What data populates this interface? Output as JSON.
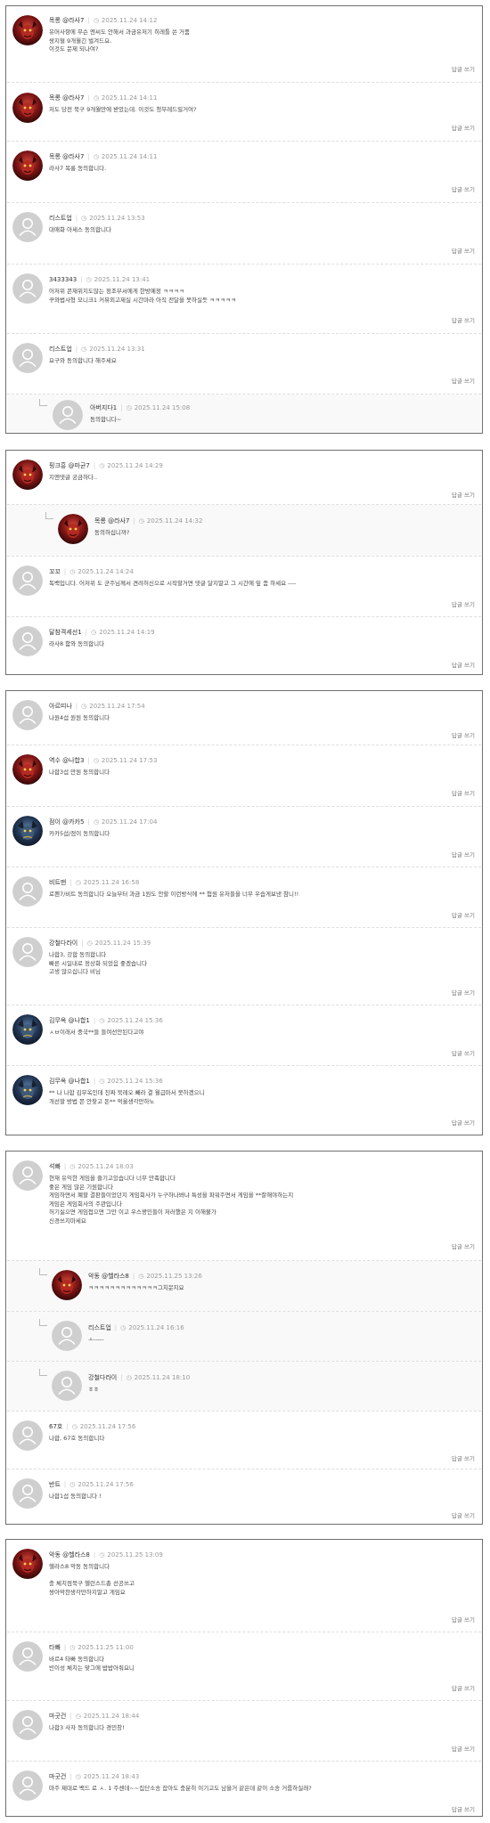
{
  "reply_label": "답글 쓰기",
  "threads": [
    {
      "comments": [
        {
          "author": "목롱 @라사7",
          "time": "2025.11.24 14:12",
          "avatar": "red",
          "text": "유머사항에 무슨 엔씨도 안해서 과금유저기 히레틀 쓴 거품\n쌍지혈 9개월긴 벌겨드요.\n이것도 문제 되나여?"
        },
        {
          "author": "목롱 @라사7",
          "time": "2025.11.24 14:11",
          "avatar": "red",
          "text": "저도 당전 북구 9개월만에 받았는데. 이것도 청무레드릴거여?"
        },
        {
          "author": "목롱 @라사7",
          "time": "2025.11.24 14:11",
          "avatar": "red",
          "text": "라사7 목롱 동의합니다."
        },
        {
          "author": "리스트업",
          "time": "2025.11.24 13:53",
          "avatar": "gray",
          "text": "대애화 아세스 동의합니다"
        },
        {
          "author": "3433343",
          "time": "2025.11.24 13:41",
          "avatar": "gray",
          "text": "어저위 콘재위지도많는 정조부서에게 한방예정 ㅋㅋㅋㅋ\n꾸와법사형 모니크1 커뮤외고제실 시간마라 아직 전달을 못하실듯 ㅋㅋㅋㅋㅋ"
        },
        {
          "author": "리스트업",
          "time": "2025.11.24 13:31",
          "avatar": "gray",
          "text": "요구와 동의합니다 해주세요"
        },
        {
          "author": "아버지다1",
          "time": "2025.11.24 15:08",
          "avatar": "gray",
          "text": "동의합니다~",
          "reply": true
        }
      ]
    },
    {
      "comments": [
        {
          "author": "핑크흥 @마균7",
          "time": "2025.11.24 14:29",
          "avatar": "red",
          "text": "지엔댓글 궁금하다.."
        },
        {
          "author": "목롱 @라사7",
          "time": "2025.11.24 14:32",
          "avatar": "red",
          "text": "동의하십니까?",
          "reply": true
        },
        {
          "author": "꼬꼬",
          "time": "2025.11.24 14:24",
          "avatar": "gray",
          "text": "독백입니다. 어저위 도 군주님께서 견려허신으로 시작할거면 댓글 달지말고 그 시간에 잎 좀 하세요 ----"
        },
        {
          "author": "달참격세선1",
          "time": "2025.11.24 14:19",
          "avatar": "gray",
          "text": "라사8 함와 동의합니다"
        }
      ]
    },
    {
      "comments": [
        {
          "author": "아르띠나",
          "time": "2025.11.24 17:54",
          "avatar": "gray",
          "text": "나원4섭 원원 동의합니다"
        },
        {
          "author": "역수 @나합3",
          "time": "2025.11.24 17:53",
          "avatar": "red",
          "text": "나합3섭 만원 동의합니다"
        },
        {
          "author": "점이 @카카5",
          "time": "2025.11.24 17:04",
          "avatar": "blue",
          "text": "카카5섭/점이 동의합니다"
        },
        {
          "author": "비트맨",
          "time": "2025.11.24 16:58",
          "avatar": "gray",
          "text": "로펜7/비트 동의합니다 오늘부터 과금 1원도 안할 이런방식에 ** 험원 유저들을 너무 우습게보낸 참니!!"
        },
        {
          "author": "강철다라이",
          "time": "2025.11.24 15:39",
          "avatar": "gray",
          "text": "나합3, 강합 동의합니다\n빠른 시일내로 정상화 되었음 좋겠습니다\n고생 많으십니다 비님"
        },
        {
          "author": "김무옥 @나합1",
          "time": "2025.11.24 15:36",
          "avatar": "blue",
          "text": "ㅅㅂ이래서 중국**들 들여선안된다고야"
        },
        {
          "author": "김무옥 @나합1",
          "time": "2025.11.24 15:36",
          "avatar": "blue",
          "text": "** 나 나합 김무옥인데 진짜 북레오 빼라 결 월급마서 못하겠으니\n개선할 방법 쯘 안찾고 돈** 억울생각만하노"
        }
      ]
    },
    {
      "comments": [
        {
          "author": "석빠",
          "time": "2025.11.24 18:03",
          "avatar": "gray",
          "text": "현재 유익한 게임을 즐기고있습니다 너무 만족합니다\n좋은 게임 많은 기원합니다\n게임하면서 폐할 결판들이었던지 게임회사가 누구하나봐냐 특성을 파워주면서 게임을 **잘해야하는지\n게임은 게임회사의 주관입니다\n허기싫으면 게임접으면 그만 이고 우스꽝인들이 저러했은 지 이해불가\n신경쓰지마세요"
        },
        {
          "author": "악동 @헬라스8",
          "time": "2025.11.25 13:26",
          "avatar": "red",
          "text": "ㅋㅋㅋㅋㅋㅋㅋㅋㅋㅋㅋㅋㅋ그치문지요",
          "reply": true
        },
        {
          "author": "리스트업",
          "time": "2025.11.24 16:16",
          "avatar": "gray",
          "text": "ㅗ-----",
          "reply": true
        },
        {
          "author": "강철다라이",
          "time": "2025.11.24 18:10",
          "avatar": "gray",
          "text": "ㅎㅎ",
          "reply": true
        },
        {
          "author": "67호",
          "time": "2025.11.24 17:56",
          "avatar": "gray",
          "text": "나합, 67호 동의합니다"
        },
        {
          "author": "반트",
          "time": "2025.11.24 17:56",
          "avatar": "gray",
          "text": "나합1섭 동의합니다 !"
        }
      ]
    },
    {
      "comments": [
        {
          "author": "악동 @헬라스8",
          "time": "2025.11.25 13:09",
          "avatar": "red",
          "text": "헬라스8 악동 동의합니다\n\n충 체치점북구 헬런스드총 선공쓰고\n쌍아막찬생각만하지말고 게임요"
        },
        {
          "author": "타빠",
          "time": "2025.11.25 11:00",
          "avatar": "gray",
          "text": "바르4 타빠 동의합니다\n빈이성 체치는 맞그에 밥밥아줘요니"
        },
        {
          "author": "마굿건",
          "time": "2025.11.24 18:44",
          "avatar": "gray",
          "text": "나합3 사자 동의합니다 경민창!"
        },
        {
          "author": "마굿건",
          "time": "2025.11.24 18:43",
          "avatar": "gray",
          "text": "마주 제대로 백드 로 ㅅ. 1 주센데~~집단소송 잡아도 충분히 이기고도 남을거 같은데 같이 소송 거룹하실래?"
        }
      ]
    }
  ]
}
